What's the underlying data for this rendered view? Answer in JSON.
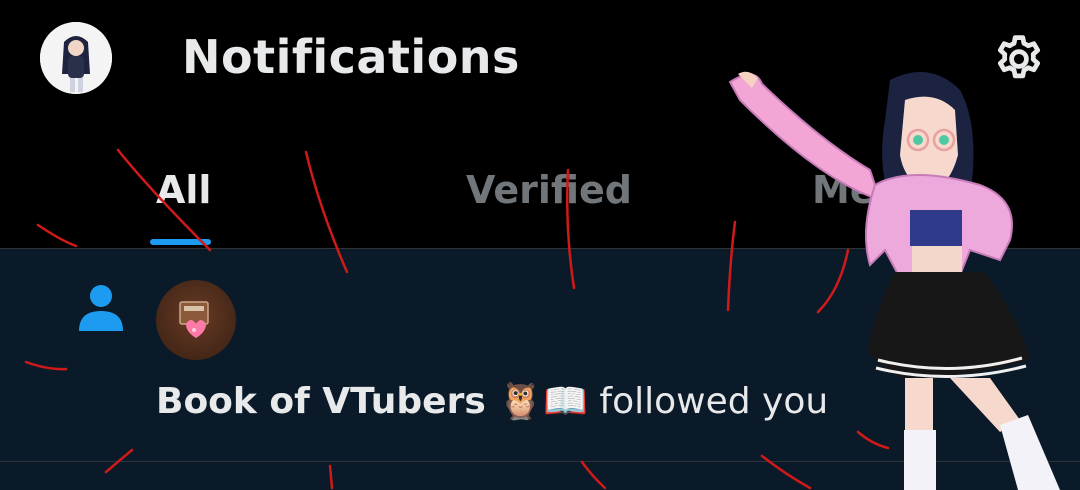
{
  "header": {
    "title": "Notifications",
    "settings_icon": "gear-icon"
  },
  "tabs": [
    {
      "label": "All",
      "active": true
    },
    {
      "label": "Verified",
      "active": false
    },
    {
      "label": "Mentions",
      "active": false
    }
  ],
  "notification": {
    "type_icon": "person-icon",
    "user_name": "Book of VTubers 🦉📖",
    "action": "followed you"
  },
  "colors": {
    "background": "#000000",
    "accent": "#1d9bf0",
    "highlight_row": "#0a1a28",
    "text_primary": "#e7e9ea",
    "text_secondary": "#71767b",
    "scribble": "#d01a1a"
  }
}
